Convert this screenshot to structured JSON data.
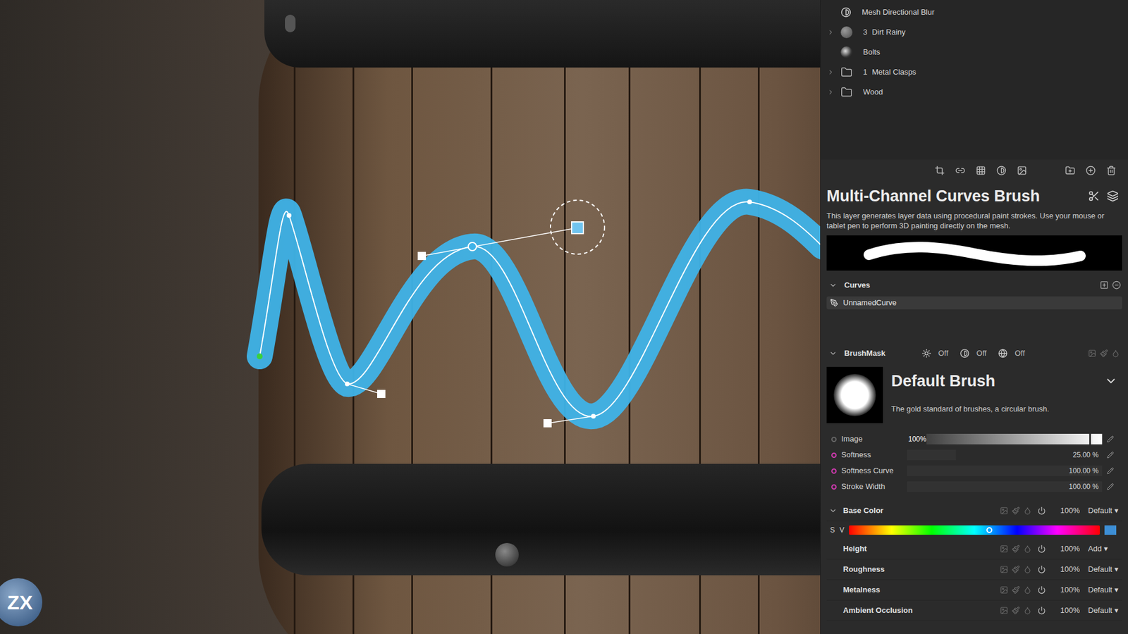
{
  "viewport": {
    "logo": "ZX"
  },
  "layers": [
    {
      "name": "Mesh Directional Blur",
      "kind": "filter",
      "expandable": false,
      "expanded": false
    },
    {
      "name": "Dirt Rainy",
      "count": "3",
      "kind": "paint",
      "expandable": true,
      "expanded": false
    },
    {
      "name": "Bolts",
      "kind": "image",
      "expandable": false,
      "expanded": false
    },
    {
      "name": "Metal Clasps",
      "count": "1",
      "kind": "folder",
      "expandable": true,
      "expanded": false
    },
    {
      "name": "Wood",
      "kind": "folder",
      "expandable": true,
      "expanded": false
    }
  ],
  "layer_properties": {
    "title": "Multi-Channel Curves Brush",
    "description": "This layer generates layer data using procedural paint strokes. Use your mouse or tablet pen to perform 3D painting directly on the mesh."
  },
  "curves": {
    "title": "Curves",
    "expanded": true,
    "items": [
      {
        "name": "UnnamedCurve",
        "selected": true
      }
    ]
  },
  "brush_mask": {
    "title": "BrushMask",
    "expanded": true,
    "toggles": [
      {
        "label": "Off",
        "on": false
      },
      {
        "label": "Off",
        "on": false
      },
      {
        "label": "Off",
        "on": false
      }
    ],
    "brush": {
      "name": "Default Brush",
      "description": "The gold standard of brushes, a circular brush."
    },
    "params": [
      {
        "label": "Image",
        "value": "100%",
        "level": 1,
        "kind": "gradient",
        "linked": false
      },
      {
        "label": "Softness",
        "value": "25.00 %",
        "level": 0.25,
        "kind": "slider",
        "linked": true
      },
      {
        "label": "Softness Curve",
        "value": "100.00 %",
        "level": 1,
        "kind": "slider",
        "linked": true
      },
      {
        "label": "Stroke Width",
        "value": "100.00 %",
        "level": 1,
        "kind": "slider",
        "linked": true
      }
    ]
  },
  "channels": [
    {
      "name": "Base Color",
      "expanded": true,
      "opacity": "100%",
      "blend": "Default",
      "labels": [
        "S",
        "V"
      ],
      "hue_level": 0.56,
      "color": "#3d8fd6"
    },
    {
      "name": "Height",
      "expanded": false,
      "opacity": "100%",
      "blend": "Add"
    },
    {
      "name": "Roughness",
      "expanded": false,
      "opacity": "100%",
      "blend": "Default"
    },
    {
      "name": "Metalness",
      "expanded": false,
      "opacity": "100%",
      "blend": "Default"
    },
    {
      "name": "Ambient Occlusion",
      "expanded": false,
      "opacity": "100%",
      "blend": "Default"
    }
  ]
}
